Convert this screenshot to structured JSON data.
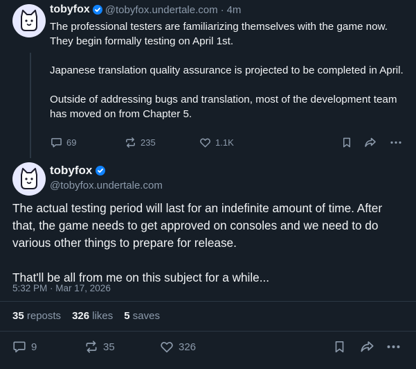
{
  "post1": {
    "author": "tobyfox",
    "handle": "@tobyfox.undertale.com",
    "separator": "·",
    "time": "4m",
    "paragraphs": [
      "The professional testers are familiarizing themselves with the game now. They begin formally testing on April 1st.",
      "Japanese translation quality assurance is projected to be completed in April.",
      "Outside of addressing bugs and translation, most of the development team has moved on from Chapter 5."
    ],
    "replies": "69",
    "reposts": "235",
    "likes": "1.1K"
  },
  "post2": {
    "author": "tobyfox",
    "handle": "@tobyfox.undertale.com",
    "paragraphs": [
      "The actual testing period will last for an indefinite amount of time. After that, the game needs to get approved on consoles and we need to do various other things to prepare for release.",
      "That'll be all from me on this subject for a while..."
    ],
    "timestamp": "5:32 PM · Mar 17, 2026",
    "stats": {
      "reposts_count": "35",
      "reposts_label": "reposts",
      "likes_count": "326",
      "likes_label": "likes",
      "saves_count": "5",
      "saves_label": "saves"
    },
    "replies": "9",
    "reposts": "35",
    "likes": "326"
  },
  "icons": {
    "verified": "verified-check-icon",
    "reply": "speech-bubble-icon",
    "repost": "repost-arrows-icon",
    "like": "heart-icon",
    "bookmark": "bookmark-icon",
    "share": "share-arrow-icon",
    "more": "ellipsis-icon"
  },
  "colors": {
    "background": "#161e27",
    "text": "#f1f3f5",
    "muted": "#8c9aab",
    "verified": "#1083fe",
    "avatar_bg": "#e7e9ff"
  }
}
